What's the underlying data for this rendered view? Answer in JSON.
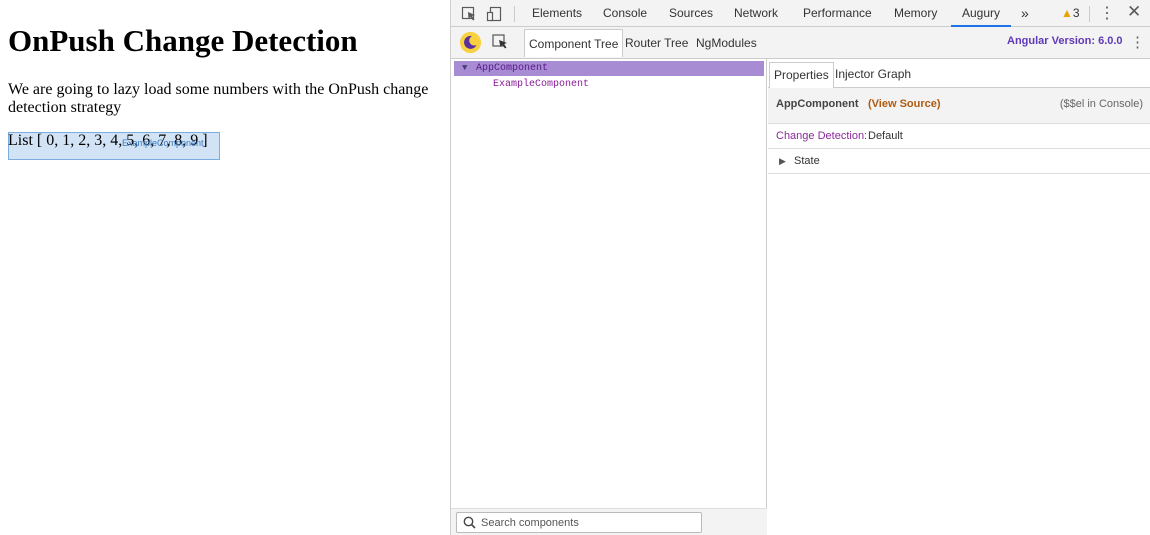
{
  "page": {
    "title": "OnPush Change Detection",
    "intro": "We are going to lazy load some numbers with the OnPush change detection strategy",
    "list_text": "List [ 0, 1, 2, 3, 4, 5, 6, 7, 8, 9 ]",
    "highlight_label": "ExampleComponent"
  },
  "devtools": {
    "tabs": [
      {
        "label": "Elements",
        "active": false
      },
      {
        "label": "Console",
        "active": false
      },
      {
        "label": "Sources",
        "active": false
      },
      {
        "label": "Network",
        "active": false
      },
      {
        "label": "Performance",
        "active": false
      },
      {
        "label": "Memory",
        "active": false
      },
      {
        "label": "Augury",
        "active": true
      }
    ],
    "more_tabs_glyph": "»",
    "warning_count": "3"
  },
  "augury": {
    "tabs": [
      {
        "label": "Component Tree",
        "active": true
      },
      {
        "label": "Router Tree",
        "active": false
      },
      {
        "label": "NgModules",
        "active": false
      }
    ],
    "angular_version": "Angular Version: 6.0.0",
    "tree": {
      "root": "AppComponent",
      "child": "ExampleComponent"
    },
    "search_placeholder": "Search components",
    "properties": {
      "tabs": [
        {
          "label": "Properties",
          "active": true
        },
        {
          "label": "Injector Graph",
          "active": false
        }
      ],
      "component_name": "AppComponent",
      "view_source": "(View Source)",
      "console_hint": "($$el in Console)",
      "change_detection_label": "Change Detection:",
      "change_detection_value": "Default",
      "state_label": "State"
    }
  },
  "colors": {
    "tree_selected": "#a78bd3",
    "angular_version": "#6039b8",
    "view_source": "#b05a10",
    "active_tab_underline": "#1a73e8"
  }
}
